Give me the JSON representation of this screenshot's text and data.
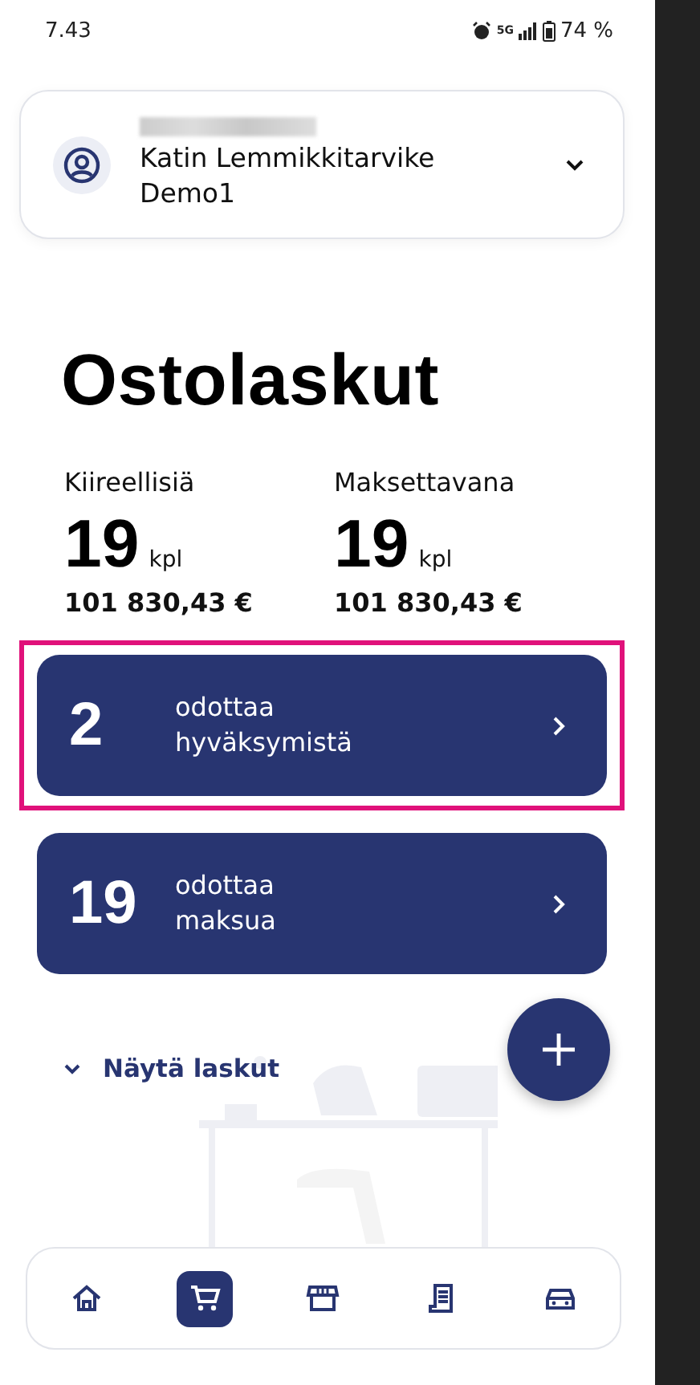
{
  "status_bar": {
    "time": "7.43",
    "network": "5G",
    "battery": "74 %"
  },
  "account": {
    "company": "Katin Lemmikkitarvike Demo1",
    "name_redacted": true
  },
  "title": "Ostolaskut",
  "stats": [
    {
      "label": "Kiireellisiä",
      "count": "19",
      "unit": "kpl",
      "amount": "101 830,43 €"
    },
    {
      "label": "Maksettavana",
      "count": "19",
      "unit": "kpl",
      "amount": "101 830,43 €"
    }
  ],
  "tasks": [
    {
      "count": "2",
      "text": "odottaa hyväksymistä",
      "highlighted": true
    },
    {
      "count": "19",
      "text": "odottaa maksua",
      "highlighted": false
    }
  ],
  "show_invoices": {
    "label": "Näytä laskut",
    "expanded": false
  },
  "nav": [
    {
      "kind": "home",
      "selected": false
    },
    {
      "kind": "cart",
      "selected": true
    },
    {
      "kind": "store",
      "selected": false
    },
    {
      "kind": "receipt",
      "selected": false
    },
    {
      "kind": "car",
      "selected": false
    }
  ]
}
